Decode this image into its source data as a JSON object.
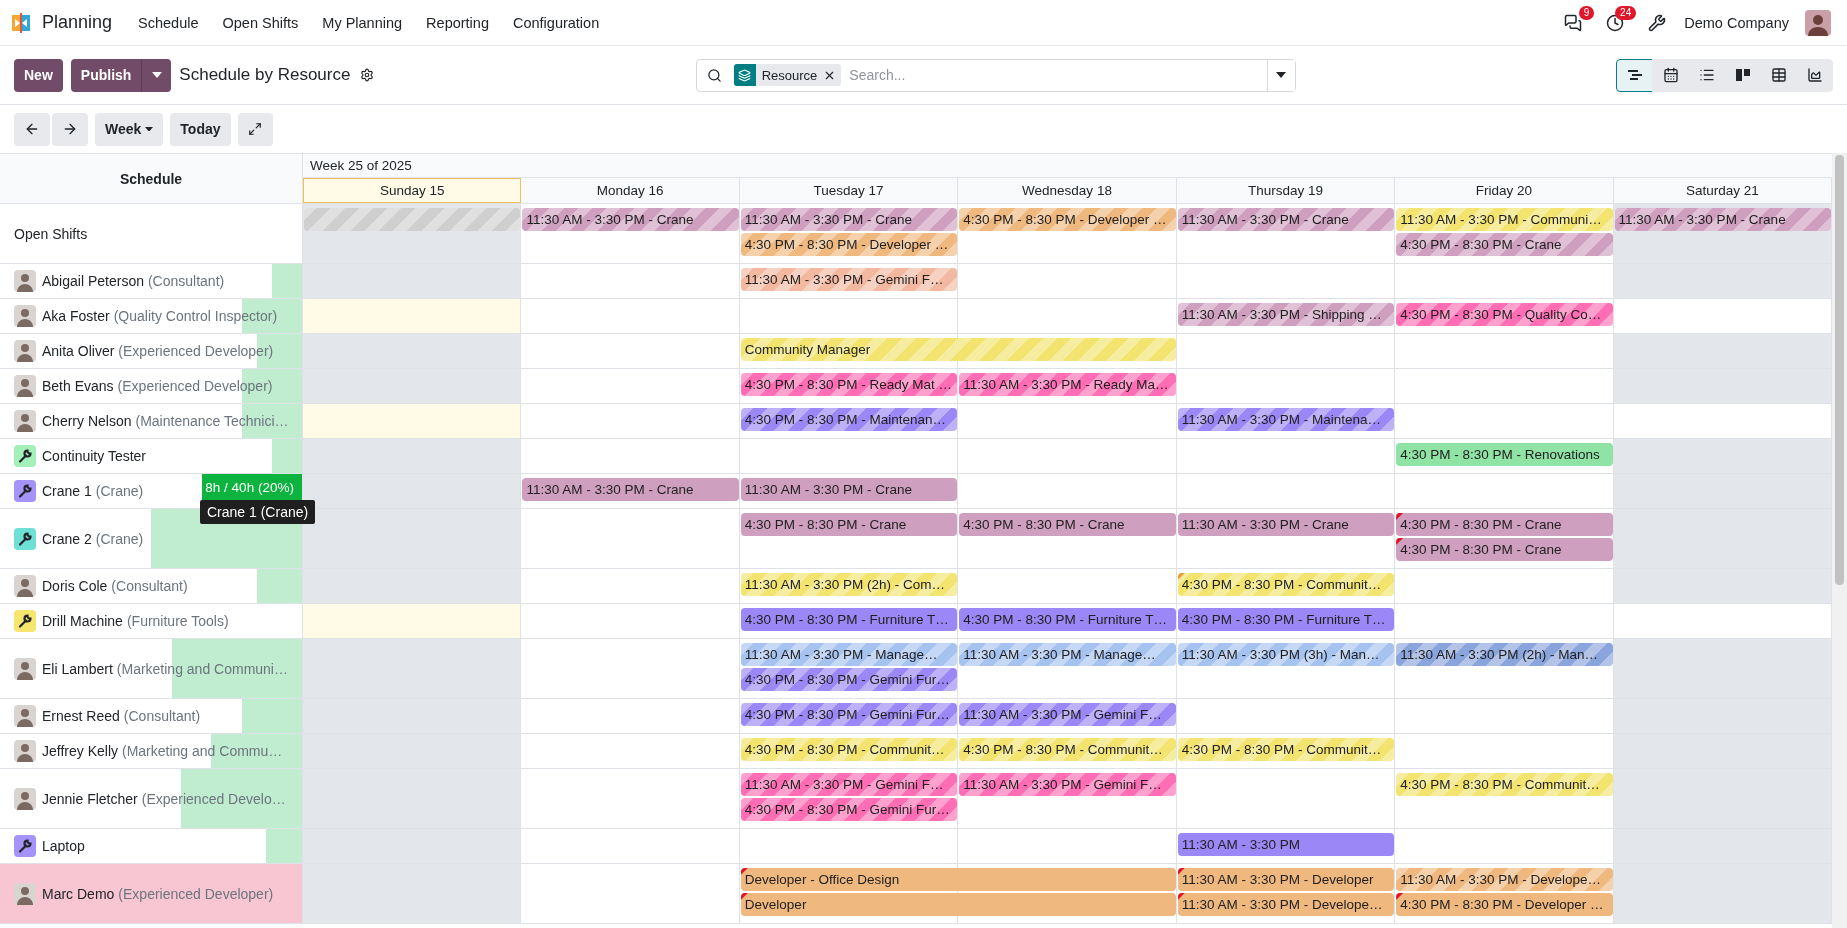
{
  "app": {
    "name": "Planning"
  },
  "menu": [
    "Schedule",
    "Open Shifts",
    "My Planning",
    "Reporting",
    "Configuration"
  ],
  "systray": {
    "messages_badge": "9",
    "activities_badge": "24",
    "company": "Demo Company"
  },
  "actions": {
    "new": "New",
    "publish": "Publish"
  },
  "breadcrumb": "Schedule by Resource",
  "search": {
    "facet": "Resource",
    "placeholder": "Search..."
  },
  "views": [
    {
      "kind": "gantt",
      "selected": true
    },
    {
      "kind": "calendar",
      "selected": false
    },
    {
      "kind": "list",
      "selected": false
    },
    {
      "kind": "kanban",
      "selected": false
    },
    {
      "kind": "pivot",
      "selected": false
    },
    {
      "kind": "graph",
      "selected": false
    }
  ],
  "nav": {
    "period": "Week",
    "today": "Today"
  },
  "gantt": {
    "corner": "Schedule",
    "week": "Week 25 of 2025",
    "days": [
      {
        "label": "Sunday 15",
        "today": true,
        "weekend": true
      },
      {
        "label": "Monday 16",
        "today": false,
        "weekend": false
      },
      {
        "label": "Tuesday 17",
        "today": false,
        "weekend": false
      },
      {
        "label": "Wednesday 18",
        "today": false,
        "weekend": false
      },
      {
        "label": "Thursday 19",
        "today": false,
        "weekend": false
      },
      {
        "label": "Friday 20",
        "today": false,
        "weekend": false
      },
      {
        "label": "Saturday 21",
        "today": false,
        "weekend": true
      }
    ],
    "rows": [
      {
        "kind": "group",
        "name": "Open Shifts",
        "weekend_off": true,
        "lanes": [
          [
            {
              "kind": "shift",
              "color": "#cfcfcf",
              "striped": true
            },
            {
              "kind": "shift",
              "text": "11:30 AM - 3:30 PM - Crane",
              "color": "#cf9fc0",
              "striped": true
            },
            {
              "kind": "shift",
              "text": "11:30 AM - 3:30 PM - Crane",
              "color": "#cf9fc0",
              "striped": true
            },
            {
              "kind": "shift",
              "text": "4:30 PM - 8:30 PM - Developer …",
              "color": "#efb87f",
              "striped": true
            },
            {
              "kind": "shift",
              "text": "11:30 AM - 3:30 PM - Crane",
              "color": "#cf9fc0",
              "striped": true
            },
            {
              "kind": "shift",
              "text": "11:30 AM - 3:30 PM - Communi…",
              "color": "#f2e46e",
              "striped": true
            },
            {
              "kind": "shift",
              "text": "11:30 AM - 3:30 PM - Crane",
              "color": "#cf9fc0",
              "striped": true
            }
          ],
          [
            {
              "kind": "empty"
            },
            {
              "kind": "empty"
            },
            {
              "kind": "shift",
              "text": "4:30 PM - 8:30 PM - Developer …",
              "color": "#efb87f",
              "striped": true
            },
            {
              "kind": "empty"
            },
            {
              "kind": "empty"
            },
            {
              "kind": "shift",
              "text": "4:30 PM - 8:30 PM - Crane",
              "color": "#cf9fc0",
              "striped": true
            }
          ]
        ]
      },
      {
        "kind": "person",
        "name": "Abigail Peterson",
        "role": "(Consultant)",
        "weekend_off": true,
        "workload": {
          "level": 0.1,
          "overloaded": false
        },
        "lanes": [
          [
            {
              "kind": "empty"
            },
            {
              "kind": "empty"
            },
            {
              "kind": "shift",
              "text": "11:30 AM - 3:30 PM - Gemini F…",
              "color": "#f2b9a0",
              "striped": true
            }
          ]
        ]
      },
      {
        "kind": "person",
        "name": "Aka Foster",
        "role": "(Quality Control Inspector)",
        "weekend_off": false,
        "workload": {
          "level": 0.2,
          "overloaded": false
        },
        "lanes": [
          [
            {
              "kind": "empty"
            },
            {
              "kind": "empty"
            },
            {
              "kind": "empty"
            },
            {
              "kind": "empty"
            },
            {
              "kind": "shift",
              "text": "11:30 AM - 3:30 PM - Shipping …",
              "color": "#cf9fc0",
              "striped": true
            },
            {
              "kind": "shift",
              "text": "4:30 PM - 8:30 PM - Quality Co…",
              "color": "#ff6eb4",
              "striped": true
            }
          ]
        ]
      },
      {
        "kind": "person",
        "name": "Anita Oliver",
        "role": "(Experienced Developer)",
        "weekend_off": true,
        "workload": {
          "level": 0.15,
          "overloaded": false
        },
        "lanes": [
          [
            {
              "kind": "empty"
            },
            {
              "kind": "empty"
            },
            {
              "kind": "shift",
              "wide": true,
              "text": "Community Manager",
              "color": "#f2e46e",
              "striped": true
            }
          ]
        ]
      },
      {
        "kind": "person",
        "name": "Beth Evans",
        "role": "(Experienced Developer)",
        "weekend_off": true,
        "workload": {
          "level": 0.2,
          "overloaded": false
        },
        "lanes": [
          [
            {
              "kind": "empty"
            },
            {
              "kind": "empty"
            },
            {
              "kind": "shift",
              "text": "4:30 PM - 8:30 PM - Ready Mat …",
              "color": "#ff6eb4",
              "striped": true
            },
            {
              "kind": "shift",
              "text": "11:30 AM - 3:30 PM - Ready Ma…",
              "color": "#ff6eb4",
              "striped": true
            }
          ]
        ]
      },
      {
        "kind": "person",
        "name": "Cherry Nelson",
        "role": "(Maintenance Technici…",
        "weekend_off": false,
        "workload": {
          "level": 0.2,
          "overloaded": false
        },
        "lanes": [
          [
            {
              "kind": "empty"
            },
            {
              "kind": "empty"
            },
            {
              "kind": "shift",
              "text": "4:30 PM - 8:30 PM - Maintenan…",
              "color": "#9b87f5",
              "striped": true
            },
            {
              "kind": "empty"
            },
            {
              "kind": "shift",
              "text": "11:30 AM - 3:30 PM - Maintena…",
              "color": "#9b87f5",
              "striped": true
            }
          ]
        ]
      },
      {
        "kind": "material",
        "name": "Continuity Tester",
        "color": "#a3f0b8",
        "weekend_off": true,
        "workload": {
          "level": 0.1,
          "overloaded": false
        },
        "lanes": [
          [
            {
              "kind": "empty"
            },
            {
              "kind": "empty"
            },
            {
              "kind": "empty"
            },
            {
              "kind": "empty"
            },
            {
              "kind": "empty"
            },
            {
              "kind": "shift",
              "text": "4:30 PM - 8:30 PM - Renovations",
              "color": "#8fe3a5",
              "striped": false
            }
          ]
        ]
      },
      {
        "kind": "material",
        "name": "Crane 1",
        "role": "(Crane)",
        "color": "#a693f7",
        "weekend_off": true,
        "workload": {
          "level": 0.33,
          "overloaded": false,
          "hovered": true,
          "label": "8h / 40h (20%)"
        },
        "tooltip": "Crane 1 (Crane)",
        "lanes": [
          [
            {
              "kind": "empty"
            },
            {
              "kind": "shift",
              "text": "11:30 AM - 3:30 PM - Crane",
              "color": "#cf9fc0",
              "striped": false
            },
            {
              "kind": "shift",
              "text": "11:30 AM - 3:30 PM - Crane",
              "color": "#cf9fc0",
              "striped": false
            }
          ]
        ]
      },
      {
        "kind": "material",
        "name": "Crane 2",
        "role": "(Crane)",
        "color": "#6fe0d6",
        "weekend_off": true,
        "workload": {
          "level": 0.5,
          "overloaded": false
        },
        "lanes": [
          [
            {
              "kind": "empty"
            },
            {
              "kind": "empty"
            },
            {
              "kind": "shift",
              "text": "4:30 PM - 8:30 PM - Crane",
              "color": "#cf9fc0",
              "striped": false
            },
            {
              "kind": "shift",
              "text": "4:30 PM - 8:30 PM - Crane",
              "color": "#cf9fc0",
              "striped": false
            },
            {
              "kind": "shift",
              "text": "11:30 AM - 3:30 PM - Crane",
              "color": "#cf9fc0",
              "striped": false
            },
            {
              "kind": "shift",
              "text": "4:30 PM - 8:30 PM - Crane",
              "color": "#cf9fc0",
              "striped": false,
              "flag": {
                "color": "#e0162b"
              }
            }
          ],
          [
            {
              "kind": "empty"
            },
            {
              "kind": "empty"
            },
            {
              "kind": "empty"
            },
            {
              "kind": "empty"
            },
            {
              "kind": "empty"
            },
            {
              "kind": "shift",
              "text": "4:30 PM - 8:30 PM - Crane",
              "color": "#cf9fc0",
              "striped": false,
              "flag": {
                "color": "#e0162b"
              }
            }
          ]
        ]
      },
      {
        "kind": "person",
        "name": "Doris Cole",
        "role": "(Consultant)",
        "weekend_off": true,
        "workload": {
          "level": 0.15,
          "overloaded": false
        },
        "lanes": [
          [
            {
              "kind": "empty"
            },
            {
              "kind": "empty"
            },
            {
              "kind": "shift",
              "text": "11:30 AM - 3:30 PM (2h) - Com…",
              "color": "#f2e46e",
              "striped": true
            },
            {
              "kind": "empty"
            },
            {
              "kind": "shift",
              "text": "4:30 PM - 8:30 PM - Communit…",
              "color": "#f2e46e",
              "striped": true,
              "flag": {
                "color": "#f09a30"
              }
            }
          ]
        ]
      },
      {
        "kind": "material",
        "name": "Drill Machine",
        "role": "(Furniture Tools)",
        "color": "#f7e66e",
        "weekend_off": false,
        "lanes": [
          [
            {
              "kind": "empty"
            },
            {
              "kind": "empty"
            },
            {
              "kind": "shift",
              "text": "4:30 PM - 8:30 PM - Furniture T…",
              "color": "#9b87f5",
              "striped": false
            },
            {
              "kind": "shift",
              "text": "4:30 PM - 8:30 PM - Furniture T…",
              "color": "#9b87f5",
              "striped": false
            },
            {
              "kind": "shift",
              "text": "4:30 PM - 8:30 PM - Furniture T…",
              "color": "#9b87f5",
              "striped": false
            }
          ]
        ]
      },
      {
        "kind": "person",
        "name": "Eli Lambert",
        "role": "(Marketing and Communi…",
        "weekend_off": true,
        "workload": {
          "level": 0.43,
          "overloaded": false
        },
        "lanes": [
          [
            {
              "kind": "empty"
            },
            {
              "kind": "empty"
            },
            {
              "kind": "shift",
              "text": "11:30 AM - 3:30 PM - Manage…",
              "color": "#a6c3f0",
              "striped": true
            },
            {
              "kind": "shift",
              "text": "11:30 AM - 3:30 PM - Manage…",
              "color": "#a6c3f0",
              "striped": true
            },
            {
              "kind": "shift",
              "text": "11:30 AM - 3:30 PM (3h) - Man…",
              "color": "#a6c3f0",
              "striped": true
            },
            {
              "kind": "shift",
              "text": "11:30 AM - 3:30 PM (2h) - Man…",
              "color": "#8aa4dc",
              "striped": true
            }
          ],
          [
            {
              "kind": "empty"
            },
            {
              "kind": "empty"
            },
            {
              "kind": "shift",
              "text": "4:30 PM - 8:30 PM - Gemini Fur…",
              "color": "#9b87f5",
              "striped": true
            }
          ]
        ]
      },
      {
        "kind": "person",
        "name": "Ernest Reed",
        "role": "(Consultant)",
        "weekend_off": true,
        "workload": {
          "level": 0.2,
          "overloaded": false
        },
        "lanes": [
          [
            {
              "kind": "empty"
            },
            {
              "kind": "empty"
            },
            {
              "kind": "shift",
              "text": "4:30 PM - 8:30 PM - Gemini Fur…",
              "color": "#9b87f5",
              "striped": true
            },
            {
              "kind": "shift",
              "text": "11:30 AM - 3:30 PM - Gemini F…",
              "color": "#9b87f5",
              "striped": true
            }
          ]
        ]
      },
      {
        "kind": "person",
        "name": "Jeffrey Kelly",
        "role": "(Marketing and Commu…",
        "weekend_off": true,
        "workload": {
          "level": 0.3,
          "overloaded": false
        },
        "lanes": [
          [
            {
              "kind": "empty"
            },
            {
              "kind": "empty"
            },
            {
              "kind": "shift",
              "text": "4:30 PM - 8:30 PM - Communit…",
              "color": "#f2e46e",
              "striped": true
            },
            {
              "kind": "shift",
              "text": "4:30 PM - 8:30 PM - Communit…",
              "color": "#f2e46e",
              "striped": true
            },
            {
              "kind": "shift",
              "text": "4:30 PM - 8:30 PM - Communit…",
              "color": "#f2e46e",
              "striped": true
            }
          ]
        ]
      },
      {
        "kind": "person",
        "name": "Jennie Fletcher",
        "role": "(Experienced Develo…",
        "weekend_off": true,
        "workload": {
          "level": 0.4,
          "overloaded": false
        },
        "lanes": [
          [
            {
              "kind": "empty"
            },
            {
              "kind": "empty"
            },
            {
              "kind": "shift",
              "text": "11:30 AM - 3:30 PM - Gemini F…",
              "color": "#ff6eb4",
              "striped": true
            },
            {
              "kind": "shift",
              "text": "11:30 AM - 3:30 PM - Gemini F…",
              "color": "#ff6eb4",
              "striped": true
            },
            {
              "kind": "empty"
            },
            {
              "kind": "shift",
              "text": "4:30 PM - 8:30 PM - Communit…",
              "color": "#f2e46e",
              "striped": true
            }
          ],
          [
            {
              "kind": "empty"
            },
            {
              "kind": "empty"
            },
            {
              "kind": "shift",
              "text": "4:30 PM - 8:30 PM - Gemini Fur…",
              "color": "#ff6eb4",
              "striped": true
            }
          ]
        ]
      },
      {
        "kind": "material",
        "name": "Laptop",
        "color": "#a693f7",
        "weekend_off": true,
        "workload": {
          "level": 0.12,
          "overloaded": false
        },
        "lanes": [
          [
            {
              "kind": "empty"
            },
            {
              "kind": "empty"
            },
            {
              "kind": "empty"
            },
            {
              "kind": "empty"
            },
            {
              "kind": "shift",
              "text": "11:30 AM - 3:30 PM",
              "color": "#9b87f5",
              "striped": false
            }
          ]
        ]
      },
      {
        "kind": "person",
        "name": "Marc Demo",
        "role": "(Experienced Developer)",
        "weekend_off": true,
        "workload": {
          "level": 1,
          "overloaded": true
        },
        "lanes": [
          [
            {
              "kind": "empty"
            },
            {
              "kind": "empty"
            },
            {
              "kind": "shift",
              "wide": true,
              "text": "Developer - Office Design",
              "color": "#efb87f",
              "striped": false,
              "flag": {
                "color": "#e0162b"
              }
            },
            {
              "kind": "shift",
              "text": "11:30 AM - 3:30 PM - Developer",
              "color": "#efb87f",
              "striped": false,
              "flag": {
                "color": "#e0162b"
              }
            },
            {
              "kind": "shift",
              "text": "11:30 AM - 3:30 PM - Develope…",
              "color": "#efb87f",
              "striped": true
            }
          ],
          [
            {
              "kind": "empty"
            },
            {
              "kind": "empty"
            },
            {
              "kind": "shift",
              "wide": true,
              "text": "Developer",
              "color": "#efb87f",
              "striped": false,
              "flag": {
                "color": "#e0162b"
              }
            },
            {
              "kind": "shift",
              "text": "11:30 AM - 3:30 PM - Develope…",
              "color": "#efb87f",
              "striped": false,
              "flag": {
                "color": "#e0162b"
              }
            },
            {
              "kind": "shift",
              "text": "4:30 PM - 8:30 PM - Developer …",
              "color": "#efb87f",
              "striped": false,
              "flag": {
                "color": "#e0162b"
              }
            }
          ]
        ]
      }
    ]
  }
}
